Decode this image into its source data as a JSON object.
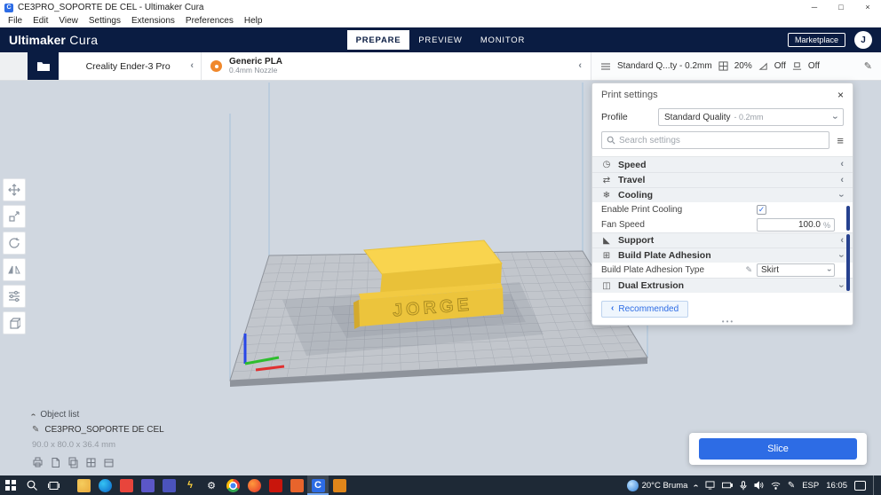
{
  "icons": {
    "minimize": "─",
    "maximize": "□",
    "close": "×",
    "chevron": "‹",
    "hamburger": "≡",
    "pencil": "✎",
    "check": "✓",
    "dots": "•••",
    "cat_speed": "◷",
    "cat_travel": "⇄",
    "cat_cooling": "❄",
    "cat_support": "◣",
    "cat_adhesion": "⊞",
    "cat_dual": "◫"
  },
  "window": {
    "title": "CE3PRO_SOPORTE DE CEL - Ultimaker Cura"
  },
  "menu": {
    "items": [
      "File",
      "Edit",
      "View",
      "Settings",
      "Extensions",
      "Preferences",
      "Help"
    ]
  },
  "header": {
    "logo_bold": "Ultimaker",
    "logo_light": " Cura",
    "tabs": [
      {
        "label": "PREPARE"
      },
      {
        "label": "PREVIEW"
      },
      {
        "label": "MONITOR"
      }
    ],
    "marketplace": "Marketplace",
    "avatar": "J"
  },
  "toolbar": {
    "printer": "Creality Ender-3 Pro",
    "material_name": "Generic PLA",
    "nozzle": "0.4mm Nozzle",
    "summary_profile": "Standard Q...ty - 0.2mm",
    "summary_infill": "20%",
    "summary_support": "Off",
    "summary_adhesion": "Off"
  },
  "print_settings": {
    "title": "Print settings",
    "profile_label": "Profile",
    "profile_value": "Standard Quality",
    "profile_suffix": "- 0.2mm",
    "search_placeholder": "Search settings",
    "categories": [
      {
        "name": "Speed",
        "state": "collapsed"
      },
      {
        "name": "Travel",
        "state": "collapsed"
      },
      {
        "name": "Cooling",
        "state": "expanded"
      },
      {
        "name": "Support",
        "state": "collapsed"
      },
      {
        "name": "Build Plate Adhesion",
        "state": "expanded"
      },
      {
        "name": "Dual Extrusion",
        "state": "expanded"
      }
    ],
    "enable_cooling_label": "Enable Print Cooling",
    "fan_speed_label": "Fan Speed",
    "fan_speed_value": "100.0",
    "fan_speed_unit": "%",
    "adhesion_type_label": "Build Plate Adhesion Type",
    "adhesion_type_value": "Skirt",
    "recommended_label": "Recommended"
  },
  "viewport": {
    "object_list_label": "Object list",
    "model_name": "CE3PRO_SOPORTE DE CEL",
    "dimensions": "90.0 x 80.0 x 36.4 mm",
    "model_text": "JORGE"
  },
  "slice": {
    "button": "Slice"
  },
  "colors": {
    "accent": "#2d6ce5",
    "header": "#0a1c42",
    "taskbar": "#1e2936",
    "scrollbar": "#26418f",
    "model_yellow": "#ecc43c"
  },
  "taskbar": {
    "weather": "20°C Bruma",
    "lang": "ESP",
    "time": "16:05",
    "apps": [
      {
        "name": "file-explorer",
        "color": "#e8a93c",
        "color2": "#f6cd5e",
        "shape": "square",
        "glyph": ""
      },
      {
        "name": "edge",
        "color": "#0a64c8",
        "color2": "#35c3f3",
        "shape": "circle",
        "glyph": ""
      },
      {
        "name": "mail",
        "color": "#e8453c",
        "shape": "square",
        "glyph": ""
      },
      {
        "name": "store",
        "color": "#5b57c8",
        "shape": "square",
        "glyph": ""
      },
      {
        "name": "teams",
        "color": "#4b53bc",
        "shape": "square",
        "glyph": ""
      },
      {
        "name": "lightning",
        "color": "",
        "shape": "none",
        "glyph": "ϟ",
        "glyph_color": "#ffd23e"
      },
      {
        "name": "settings",
        "color": "",
        "shape": "none",
        "glyph": "⚙",
        "glyph_color": "#ffffff"
      },
      {
        "name": "chrome",
        "color": "",
        "shape": "chrome",
        "glyph": ""
      },
      {
        "name": "firefox",
        "color": "#e3322b",
        "color2": "#ff9a3c",
        "shape": "circle",
        "glyph": ""
      },
      {
        "name": "acrobat",
        "color": "#c9150c",
        "shape": "square",
        "glyph": ""
      },
      {
        "name": "app-orange",
        "color": "#e8642c",
        "shape": "square",
        "glyph": ""
      },
      {
        "name": "cura",
        "color": "#2d6ce5",
        "shape": "square",
        "glyph": "C",
        "glyph_color": "#ffffff",
        "active": true
      },
      {
        "name": "app-amber",
        "color": "#e0861a",
        "shape": "square",
        "glyph": ""
      }
    ]
  }
}
